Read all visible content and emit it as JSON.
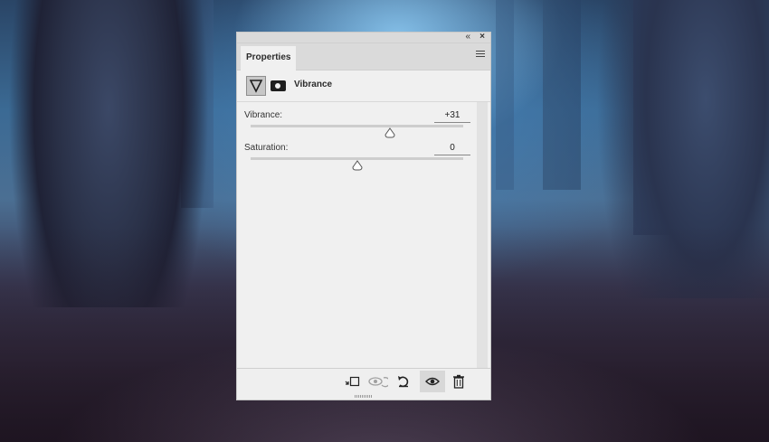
{
  "panel": {
    "tab_label": "Properties",
    "title": "Vibrance",
    "icons": {
      "collapse": "double-chevron-left-icon",
      "close": "close-icon",
      "menu": "hamburger-menu-icon",
      "adjustment": "vibrance-triangle-icon",
      "mask": "layer-mask-icon"
    }
  },
  "sliders": [
    {
      "label": "Vibrance:",
      "value": "+31",
      "numeric": 31,
      "min": -100,
      "max": 100
    },
    {
      "label": "Saturation:",
      "value": "0",
      "numeric": 0,
      "min": -100,
      "max": 100
    }
  ],
  "footer": {
    "buttons": [
      {
        "name": "clip-to-layer-button",
        "icon": "clip-to-layer-icon",
        "enabled": true
      },
      {
        "name": "view-previous-state-button",
        "icon": "eye-previous-icon",
        "enabled": false
      },
      {
        "name": "reset-button",
        "icon": "reset-icon",
        "enabled": true
      },
      {
        "name": "toggle-visibility-button",
        "icon": "eye-icon",
        "enabled": true,
        "active": true
      },
      {
        "name": "delete-button",
        "icon": "trash-icon",
        "enabled": true
      }
    ]
  }
}
